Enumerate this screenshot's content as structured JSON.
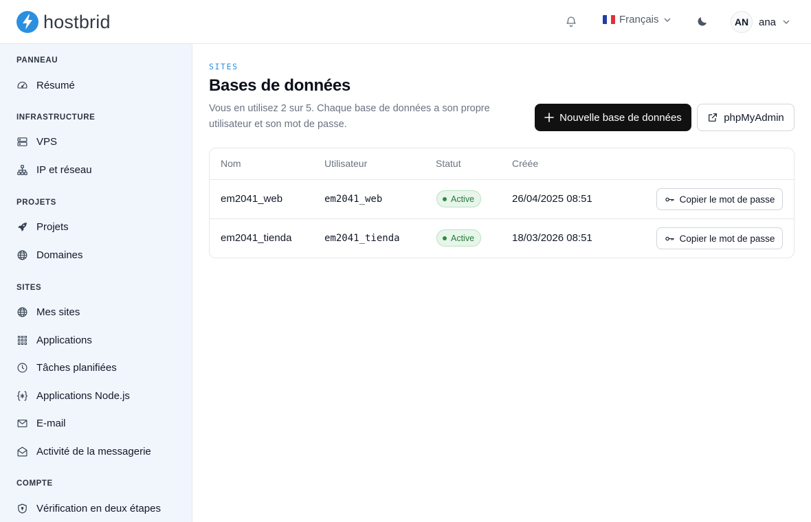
{
  "brand": {
    "name": "hostbrid",
    "accent": "#2b8fe0"
  },
  "header": {
    "language": "Français",
    "user_initials": "AN",
    "user_name": "ana"
  },
  "sidebar": {
    "sections": [
      {
        "title": "PANNEAU",
        "items": [
          {
            "label": "Résumé",
            "icon": "gauge-icon"
          }
        ]
      },
      {
        "title": "INFRASTRUCTURE",
        "items": [
          {
            "label": "VPS",
            "icon": "server-icon"
          },
          {
            "label": "IP et réseau",
            "icon": "network-icon"
          }
        ]
      },
      {
        "title": "PROJETS",
        "items": [
          {
            "label": "Projets",
            "icon": "rocket-icon"
          },
          {
            "label": "Domaines",
            "icon": "globe-icon"
          }
        ]
      },
      {
        "title": "SITES",
        "items": [
          {
            "label": "Mes sites",
            "icon": "globe-icon"
          },
          {
            "label": "Applications",
            "icon": "grid-icon"
          },
          {
            "label": "Tâches planifiées",
            "icon": "clock-icon"
          },
          {
            "label": "Applications Node.js",
            "icon": "braces-icon"
          },
          {
            "label": "E-mail",
            "icon": "mail-icon"
          },
          {
            "label": "Activité de la messagerie",
            "icon": "mail-activity-icon"
          }
        ]
      },
      {
        "title": "COMPTE",
        "items": [
          {
            "label": "Vérification en deux étapes",
            "icon": "shield-icon"
          }
        ]
      }
    ]
  },
  "main": {
    "eyebrow": "SITES",
    "title": "Bases de données",
    "subtitle": "Vous en utilisez 2 sur 5. Chaque base de données a son propre utilisateur et son mot de passe.",
    "new_db_label": "Nouvelle base de données",
    "phpmyadmin_label": "phpMyAdmin",
    "table": {
      "columns": [
        "Nom",
        "Utilisateur",
        "Statut",
        "Créée"
      ],
      "rows": [
        {
          "name": "em2041_web",
          "user": "em2041_web",
          "status": "Active",
          "created": "26/04/2025 08:51",
          "action": "Copier le mot de passe"
        },
        {
          "name": "em2041_tienda",
          "user": "em2041_tienda",
          "status": "Active",
          "created": "18/03/2026 08:51",
          "action": "Copier le mot de passe"
        }
      ]
    }
  }
}
